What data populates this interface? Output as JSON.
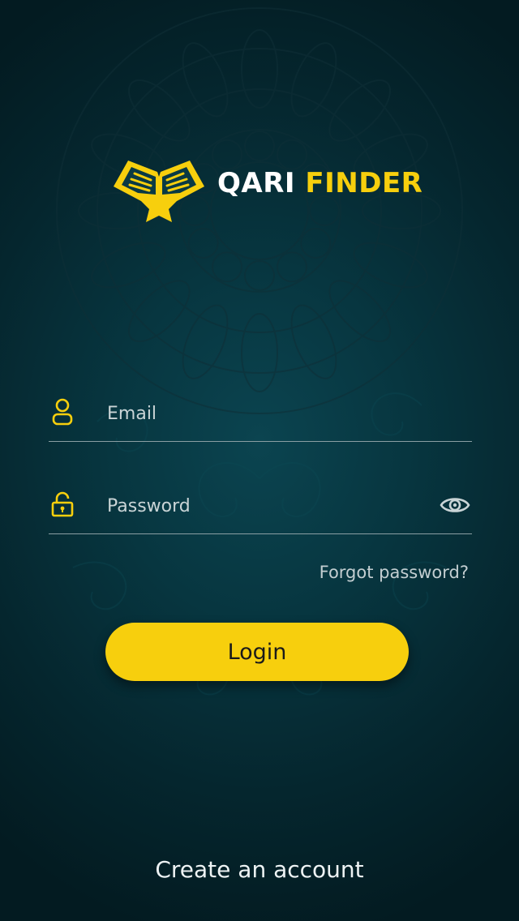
{
  "brand": {
    "word1": "QARI",
    "word2": "FINDER",
    "logo_icon": "open-quran-book-icon"
  },
  "email": {
    "placeholder": "Email",
    "value": "",
    "icon": "user-icon"
  },
  "password": {
    "placeholder": "Password",
    "value": "",
    "icon": "lock-icon",
    "toggle_icon": "eye-icon"
  },
  "forgot_label": "Forgot password?",
  "login_label": "Login",
  "create_account_label": "Create an account",
  "colors": {
    "accent": "#f7cf0d",
    "background": "#063640",
    "text": "#ffffff"
  }
}
